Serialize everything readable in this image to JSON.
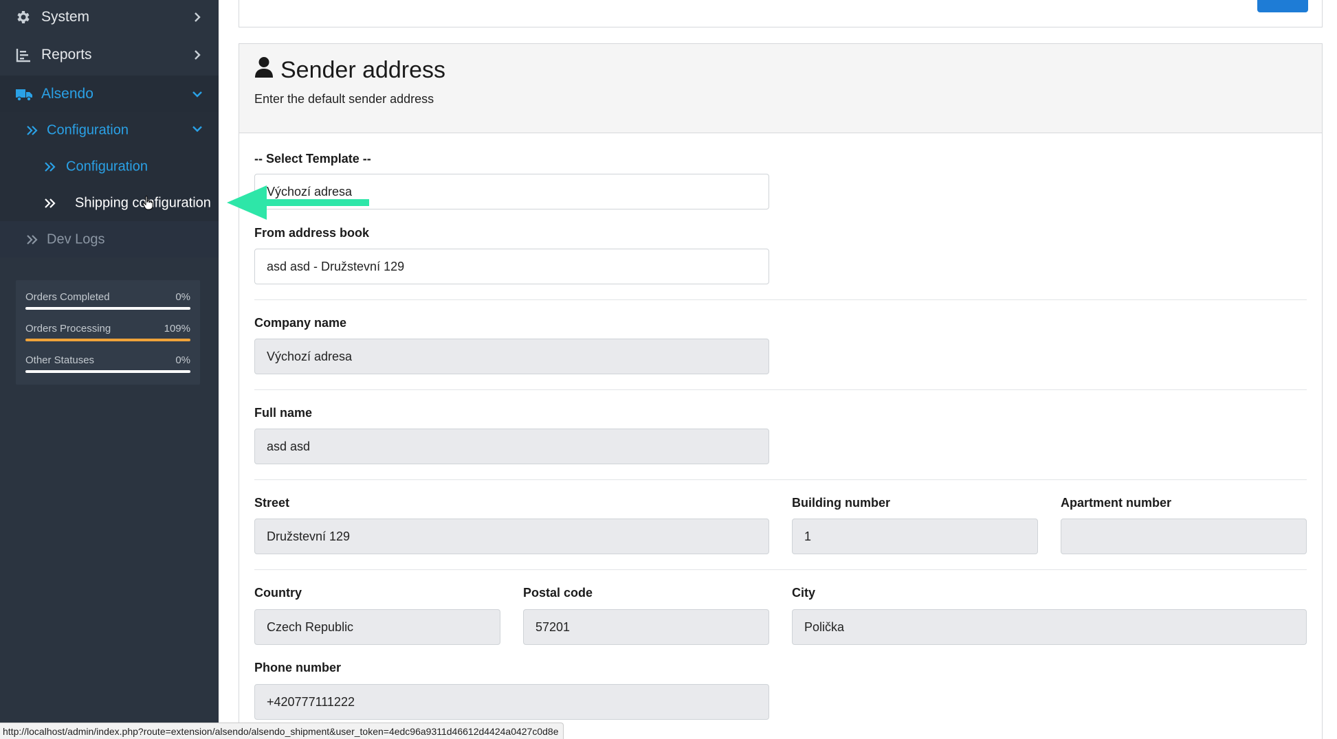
{
  "sidebar": {
    "system": {
      "label": "System",
      "icon": "gear-icon"
    },
    "reports": {
      "label": "Reports",
      "icon": "bar-chart-icon"
    },
    "alsendo": {
      "label": "Alsendo",
      "icon": "truck-icon"
    },
    "configuration_group": {
      "label": "Configuration"
    },
    "configuration_item": {
      "label": "Configuration"
    },
    "shipping_configuration": {
      "label": "Shipping configuration"
    },
    "dev_logs": {
      "label": "Dev Logs"
    },
    "colors": {
      "active": "#2aa1e6",
      "text": "#e6e9ec",
      "muted": "#8b96a3"
    }
  },
  "stats": [
    {
      "label": "Orders Completed",
      "value": "0%",
      "fill_percent": 0,
      "color": "#ffffff"
    },
    {
      "label": "Orders Processing",
      "value": "109%",
      "fill_percent": 100,
      "color": "#f0a33a"
    },
    {
      "label": "Other Statuses",
      "value": "0%",
      "fill_percent": 0,
      "color": "#ffffff"
    }
  ],
  "card": {
    "title": "Sender address",
    "subtitle": "Enter the default sender address",
    "icon": "user-icon"
  },
  "form": {
    "select_template": {
      "label": "-- Select Template --",
      "value": "Výchozí adresa"
    },
    "address_book": {
      "label": "From address book",
      "value": "asd asd - Družstevní 129"
    },
    "company_name": {
      "label": "Company name",
      "value": "Výchozí adresa"
    },
    "full_name": {
      "label": "Full name",
      "value": "asd asd"
    },
    "street": {
      "label": "Street",
      "value": "Družstevní 129"
    },
    "building_number": {
      "label": "Building number",
      "value": "1"
    },
    "apartment_number": {
      "label": "Apartment number",
      "value": ""
    },
    "country": {
      "label": "Country",
      "value": "Czech Republic"
    },
    "postal_code": {
      "label": "Postal code",
      "value": "57201"
    },
    "city": {
      "label": "City",
      "value": "Polička"
    },
    "phone_number": {
      "label": "Phone number",
      "value": "+420777111222"
    }
  },
  "status_bar": {
    "url": "http://localhost/admin/index.php?route=extension/alsendo/alsendo_shipment&user_token=4edc96a9311d46612d4424a0427c0d8e"
  },
  "annotation": {
    "arrow_color": "#2ee6a8"
  }
}
